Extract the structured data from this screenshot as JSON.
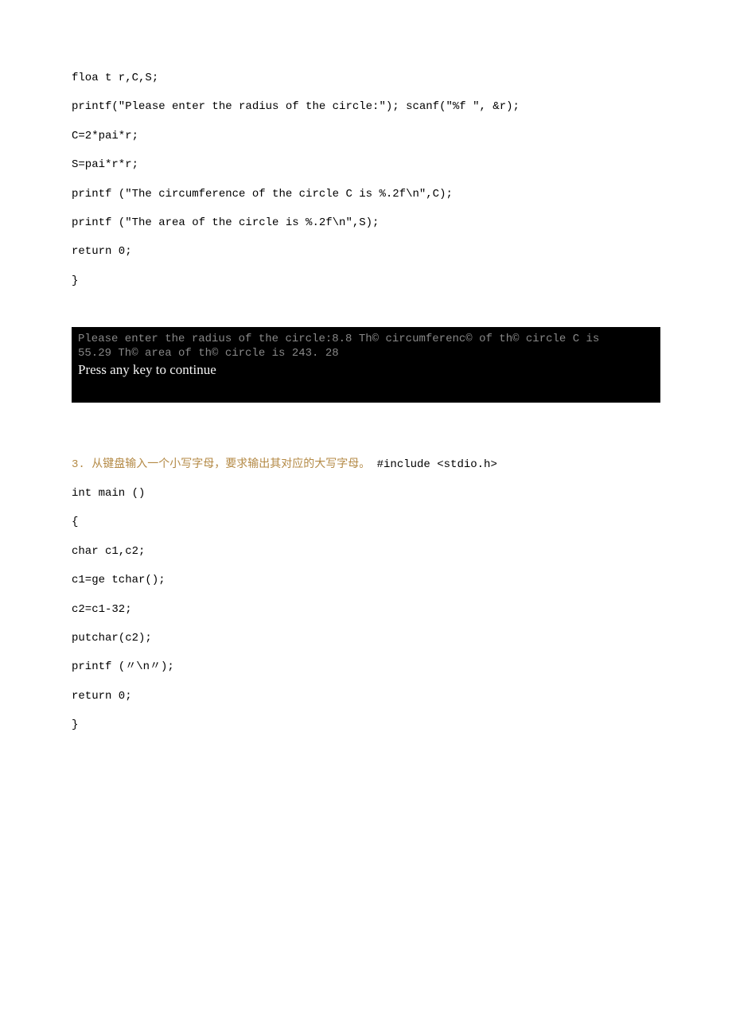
{
  "code1": {
    "l1": "floa t r,C,S;",
    "l2": "printf(\"Please enter the radius of the circle:\"); scanf(\"%f \", &r);",
    "l3": "C=2*pai*r;",
    "l4": "S=pai*r*r;",
    "l5": "printf (\"The circumference of the circle C is %.2f\\n\",C);",
    "l6": "printf (\"The area of the circle is %.2f\\n\",S);",
    "l7": "return 0;",
    "l8": "}"
  },
  "terminal": {
    "line1": "Please enter the radius of the circle:8.8 Th© circumferenc© of th© circle C is",
    "line2": "55.29 Th© area of th© circle is 243. 28",
    "line3": "Press any key to continue"
  },
  "question": {
    "num": "3. ",
    "text": "从键盘输入一个小写字母，要求输出其对应的大写字母。",
    "after": " #include  <stdio.h>"
  },
  "code2": {
    "l1": "int main ()",
    "l2": "{",
    "l3": "char c1,c2;",
    "l4": "c1=ge tchar();",
    "l5": "c2=c1-32;",
    "l6": "putchar(c2);",
    "l7": "printf (〃\\n〃);",
    "l8": "return 0;",
    "l9": "}"
  }
}
